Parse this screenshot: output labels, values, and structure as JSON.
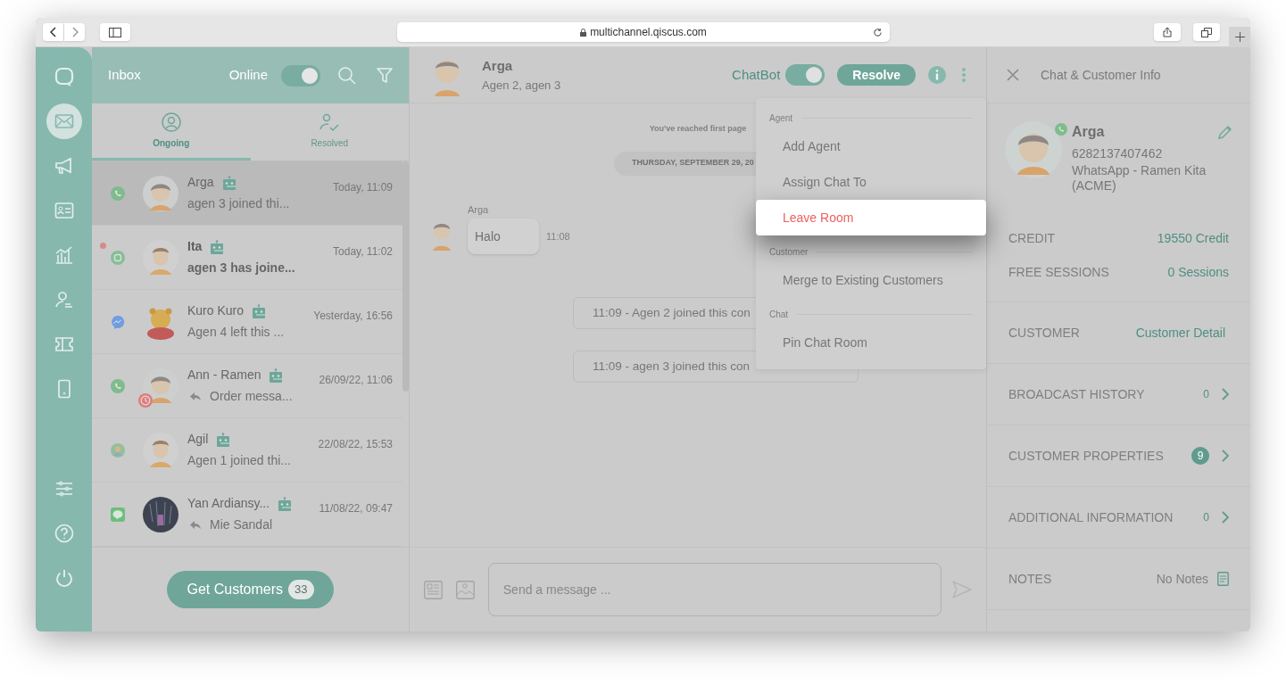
{
  "browser": {
    "url": "multichannel.qiscus.com"
  },
  "nav_items": [
    {
      "kind": "chat",
      "selected": false
    },
    {
      "kind": "inbox",
      "selected": true
    },
    {
      "kind": "broadcast",
      "selected": false
    },
    {
      "kind": "contacts",
      "selected": false
    },
    {
      "kind": "analytics",
      "selected": false
    },
    {
      "kind": "agents",
      "selected": false
    },
    {
      "kind": "tickets",
      "selected": false
    },
    {
      "kind": "mobile",
      "selected": false
    }
  ],
  "nav_bottom_items": [
    {
      "kind": "settings",
      "selected": false
    },
    {
      "kind": "help",
      "selected": false
    },
    {
      "kind": "logout",
      "selected": false
    }
  ],
  "chat_list": {
    "title": "Inbox",
    "status_label": "Online",
    "online": true,
    "tabs": [
      {
        "label": "Ongoing",
        "kind": "ongoing",
        "selected": true
      },
      {
        "label": "Resolved",
        "kind": "resolved",
        "selected": false
      }
    ],
    "conversations": [
      {
        "name": "Arga",
        "preview": "agen 3 joined thi...",
        "time": "Today, 11:09",
        "channel": {
          "kind": "whatsapp"
        },
        "avatar": {
          "kind": "boy"
        },
        "selected": true,
        "unread": false,
        "replied": false,
        "expired": false
      },
      {
        "name": "Ita",
        "preview": "agen 3 has joine...",
        "time": "Today, 11:02",
        "channel": {
          "kind": "qiscus"
        },
        "avatar": {
          "kind": "man"
        },
        "selected": false,
        "unread": true,
        "replied": false,
        "expired": false
      },
      {
        "name": "Kuro Kuro",
        "preview": "Agen 4 left this ...",
        "time": "Yesterday, 16:56",
        "channel": {
          "kind": "messenger"
        },
        "avatar": {
          "kind": "bear"
        },
        "selected": false,
        "unread": false,
        "replied": false,
        "expired": false
      },
      {
        "name": "Ann - Ramen",
        "preview": "Order messa...",
        "time": "26/09/22, 11:06",
        "channel": {
          "kind": "whatsapp"
        },
        "avatar": {
          "kind": "boy"
        },
        "selected": false,
        "unread": false,
        "replied": true,
        "expired": true
      },
      {
        "name": "Agil",
        "preview": "Agen 1 joined thi...",
        "time": "22/08/22, 15:53",
        "channel": {
          "kind": "custom"
        },
        "avatar": {
          "kind": "man"
        },
        "selected": false,
        "unread": false,
        "replied": false,
        "expired": false
      },
      {
        "name": "Yan Ardiansy...",
        "preview": "Mie Sandal",
        "time": "11/08/22, 09:47",
        "channel": {
          "kind": "line"
        },
        "avatar": {
          "kind": "photo"
        },
        "selected": false,
        "unread": false,
        "replied": true,
        "expired": false
      }
    ],
    "get_customers": {
      "label": "Get Customers",
      "count": "33"
    }
  },
  "chat": {
    "name": "Arga",
    "participants": "Agen 2, agen 3",
    "chatbot_label": "ChatBot",
    "chatbot_on": true,
    "resolve_label": "Resolve",
    "notice": "You've reached first page",
    "date": "THURSDAY, SEPTEMBER 29, 20",
    "messages": [
      {
        "kind": "incoming",
        "sender": "Arga",
        "text": "Halo",
        "time": "11:08"
      },
      {
        "kind": "system",
        "text": "11:09 - Agen 2 joined this con"
      },
      {
        "kind": "system",
        "text": "11:09 - agen 3 joined this con"
      }
    ],
    "input_placeholder": "Send a message ..."
  },
  "menu": [
    {
      "title": "Agent",
      "items": [
        {
          "label": "Add Agent",
          "selected": false
        },
        {
          "label": "Assign Chat To",
          "selected": false
        },
        {
          "label": "Leave Room",
          "selected": true
        }
      ]
    },
    {
      "title": "Customer",
      "items": [
        {
          "label": "Merge to Existing Customers",
          "selected": false
        }
      ]
    },
    {
      "title": "Chat",
      "items": [
        {
          "label": "Pin Chat Room",
          "selected": false
        }
      ]
    }
  ],
  "info_panel": {
    "title": "Chat & Customer Info",
    "name": "Arga",
    "phone": "6282137407462",
    "channel": "WhatsApp - Ramen Kita (ACME)",
    "stats": [
      {
        "label": "CREDIT",
        "value": "19550 Credit"
      },
      {
        "label": "FREE SESSIONS",
        "value": "0 Sessions"
      }
    ],
    "sections": [
      {
        "label": "CUSTOMER",
        "kind": "link",
        "value": "Customer Detail"
      },
      {
        "label": "BROADCAST HISTORY",
        "kind": "count",
        "value": "0"
      },
      {
        "label": "CUSTOMER PROPERTIES",
        "kind": "badge",
        "value": "9"
      },
      {
        "label": "ADDITIONAL INFORMATION",
        "kind": "count",
        "value": "0"
      },
      {
        "label": "NOTES",
        "kind": "notes",
        "value": "No Notes"
      }
    ]
  }
}
